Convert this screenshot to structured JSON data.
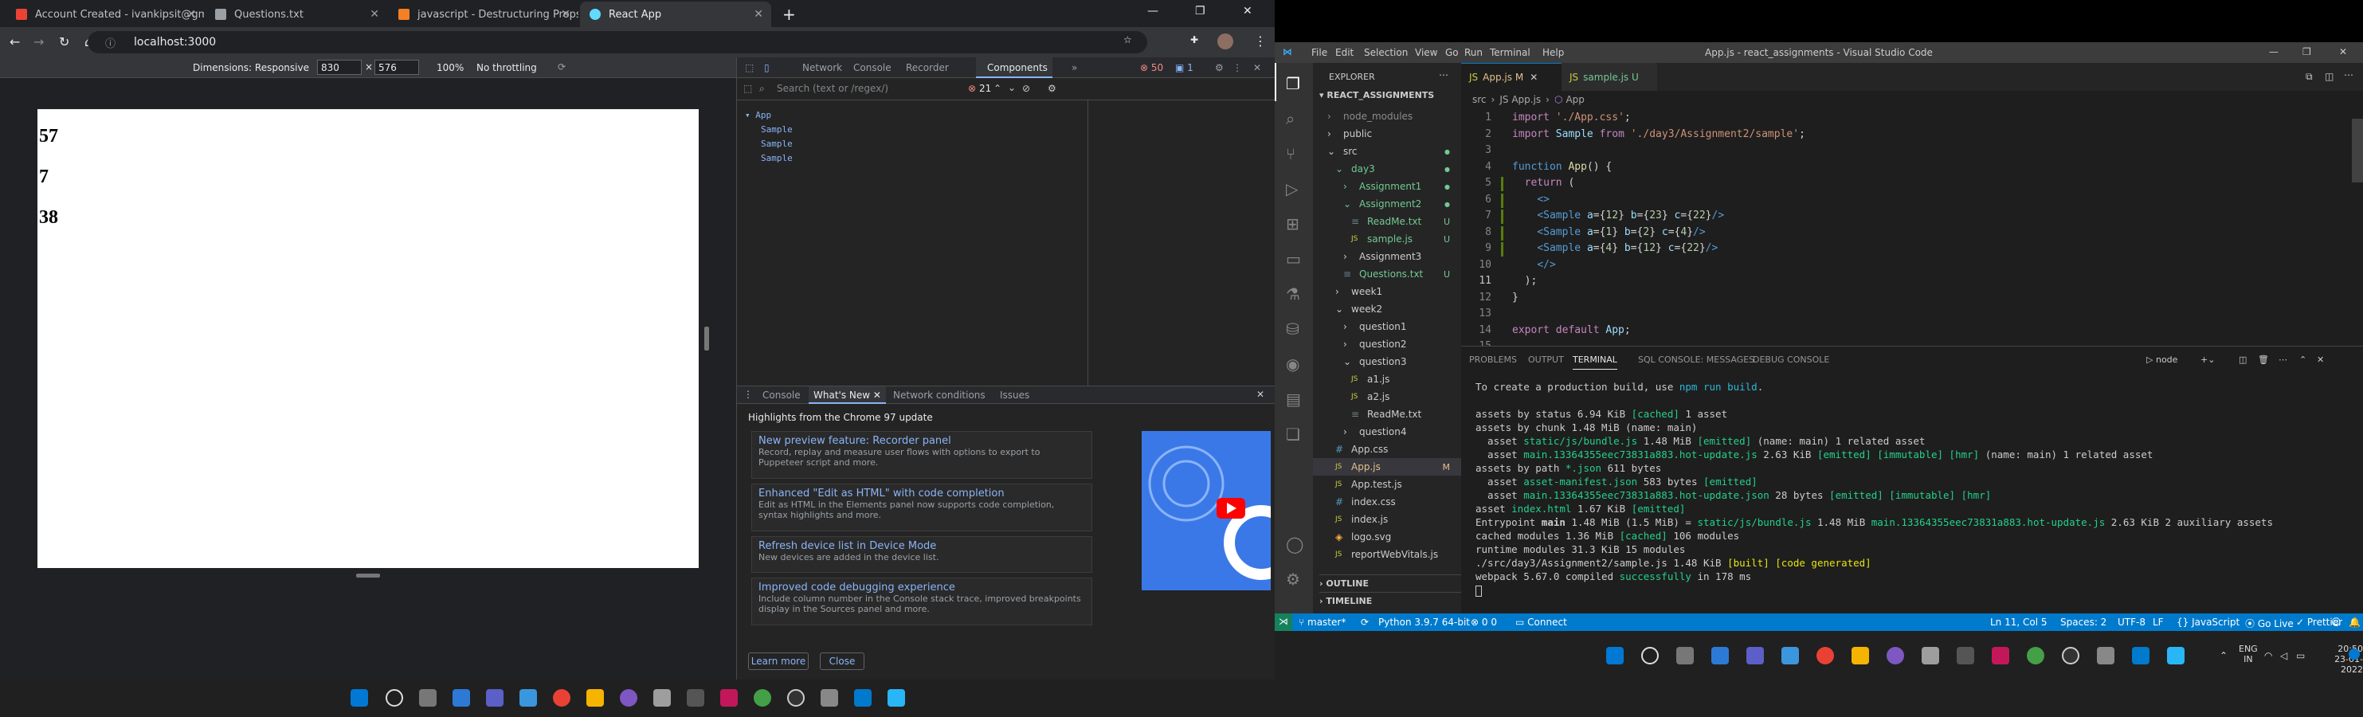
{
  "browser": {
    "tabs": [
      {
        "title": "Account Created - ivankipsit@gm",
        "fav": "#ea4335"
      },
      {
        "title": "Questions.txt",
        "fav": "#9aa0a6"
      },
      {
        "title": "javascript - Destructuring Props",
        "fav": "#f48024"
      },
      {
        "title": "React App",
        "fav": "#61dafb"
      }
    ],
    "url": "localhost:3000",
    "device": {
      "label": "Dimensions: Responsive",
      "width": "830",
      "height": "576",
      "zoom": "100%",
      "throttle": "No throttling"
    },
    "page_values": [
      "57",
      "7",
      "38"
    ]
  },
  "devtools": {
    "tabs": [
      "Network",
      "Console",
      "Recorder",
      "Components"
    ],
    "active_tab": "Components",
    "counts": {
      "errors": "50",
      "issues": "1"
    },
    "search_placeholder": "Search (text or /regex/)",
    "match_count": "21",
    "tree": {
      "root": "App",
      "children": [
        "Sample",
        "Sample",
        "Sample"
      ]
    },
    "drawer_tabs": [
      "Console",
      "What's New",
      "Network conditions",
      "Issues"
    ],
    "drawer_heading": "Highlights from the Chrome 97 update",
    "cards": [
      {
        "title": "New preview feature: Recorder panel",
        "desc": "Record, replay and measure user flows with options to export to Puppeteer script and more."
      },
      {
        "title": "Enhanced \"Edit as HTML\" with code completion",
        "desc": "Edit as HTML in the Elements panel now supports code completion, syntax highlights and more."
      },
      {
        "title": "Refresh device list in Device Mode",
        "desc": "New devices are added in the device list."
      },
      {
        "title": "Improved code debugging experience",
        "desc": "Include column number in the Console stack trace, improved breakpoints display in the Sources panel and more."
      }
    ],
    "learn_more": "Learn more",
    "close": "Close"
  },
  "vscode": {
    "menu": [
      "File",
      "Edit",
      "Selection",
      "View",
      "Go",
      "Run",
      "Terminal",
      "Help"
    ],
    "title": "App.js - react_assignments - Visual Studio Code",
    "explorer_label": "EXPLORER",
    "project": "REACT_ASSIGNMENTS",
    "tree": [
      {
        "name": "node_modules",
        "indent": 1,
        "kind": "folder",
        "color": "#8c8c8c",
        "badge": ""
      },
      {
        "name": "public",
        "indent": 1,
        "kind": "folder",
        "color": "#ccc",
        "badge": ""
      },
      {
        "name": "src",
        "indent": 1,
        "kind": "folder-open",
        "color": "#ccc",
        "badge": "dot"
      },
      {
        "name": "day3",
        "indent": 2,
        "kind": "folder-open",
        "color": "#73c991",
        "badge": "dot"
      },
      {
        "name": "Assignment1",
        "indent": 3,
        "kind": "folder",
        "color": "#73c991",
        "badge": "dot"
      },
      {
        "name": "Assignment2",
        "indent": 3,
        "kind": "folder-open",
        "color": "#73c991",
        "badge": "dot"
      },
      {
        "name": "ReadMe.txt",
        "indent": 4,
        "kind": "txt",
        "color": "#73c991",
        "badge": "U"
      },
      {
        "name": "sample.js",
        "indent": 4,
        "kind": "js",
        "color": "#73c991",
        "badge": "U"
      },
      {
        "name": "Assignment3",
        "indent": 3,
        "kind": "folder",
        "color": "#ccc",
        "badge": ""
      },
      {
        "name": "Questions.txt",
        "indent": 3,
        "kind": "txt",
        "color": "#73c991",
        "badge": "U"
      },
      {
        "name": "week1",
        "indent": 2,
        "kind": "folder",
        "color": "#ccc",
        "badge": ""
      },
      {
        "name": "week2",
        "indent": 2,
        "kind": "folder-open",
        "color": "#ccc",
        "badge": ""
      },
      {
        "name": "question1",
        "indent": 3,
        "kind": "folder",
        "color": "#ccc",
        "badge": ""
      },
      {
        "name": "question2",
        "indent": 3,
        "kind": "folder",
        "color": "#ccc",
        "badge": ""
      },
      {
        "name": "question3",
        "indent": 3,
        "kind": "folder-open",
        "color": "#ccc",
        "badge": ""
      },
      {
        "name": "a1.js",
        "indent": 4,
        "kind": "js",
        "color": "#ccc",
        "badge": ""
      },
      {
        "name": "a2.js",
        "indent": 4,
        "kind": "js",
        "color": "#ccc",
        "badge": ""
      },
      {
        "name": "ReadMe.txt",
        "indent": 4,
        "kind": "txt",
        "color": "#ccc",
        "badge": ""
      },
      {
        "name": "question4",
        "indent": 3,
        "kind": "folder",
        "color": "#ccc",
        "badge": ""
      },
      {
        "name": "App.css",
        "indent": 2,
        "kind": "css",
        "color": "#ccc",
        "badge": ""
      },
      {
        "name": "App.js",
        "indent": 2,
        "kind": "js",
        "color": "#e2c08d",
        "badge": "M"
      },
      {
        "name": "App.test.js",
        "indent": 2,
        "kind": "js",
        "color": "#ccc",
        "badge": ""
      },
      {
        "name": "index.css",
        "indent": 2,
        "kind": "css",
        "color": "#ccc",
        "badge": ""
      },
      {
        "name": "index.js",
        "indent": 2,
        "kind": "js",
        "color": "#ccc",
        "badge": ""
      },
      {
        "name": "logo.svg",
        "indent": 2,
        "kind": "svg",
        "color": "#ccc",
        "badge": ""
      },
      {
        "name": "reportWebVitals.js",
        "indent": 2,
        "kind": "js",
        "color": "#ccc",
        "badge": ""
      }
    ],
    "outline": "OUTLINE",
    "timeline": "TIMELINE",
    "editor_tabs": [
      {
        "name": "App.js",
        "flag": "M",
        "active": true
      },
      {
        "name": "sample.js",
        "flag": "U",
        "active": false
      }
    ],
    "breadcrumbs": [
      "src",
      "JS App.js",
      "App"
    ],
    "code": [
      [
        [
          "kw",
          "import "
        ],
        [
          "str",
          "'./App.css'"
        ],
        [
          "p",
          ";"
        ]
      ],
      [
        [
          "kw",
          "import "
        ],
        [
          "id",
          "Sample "
        ],
        [
          "kw",
          "from "
        ],
        [
          "str",
          "'./day3/Assignment2/sample'"
        ],
        [
          "p",
          ";"
        ]
      ],
      [],
      [
        [
          "kw",
          "function "
        ],
        [
          "fn",
          "App"
        ],
        [
          "p",
          "() {"
        ]
      ],
      [
        [
          "p",
          "  "
        ],
        [
          "kw",
          "return "
        ],
        [
          "p",
          "("
        ]
      ],
      [
        [
          "p",
          "    "
        ],
        [
          "tag",
          "<>"
        ]
      ],
      [
        [
          "p",
          "    "
        ],
        [
          "tag",
          "<Sample "
        ],
        [
          "id",
          "a"
        ],
        [
          "p",
          "={"
        ],
        [
          "num",
          "12"
        ],
        [
          "p",
          "} "
        ],
        [
          "id",
          "b"
        ],
        [
          "p",
          "={"
        ],
        [
          "num",
          "23"
        ],
        [
          "p",
          "} "
        ],
        [
          "id",
          "c"
        ],
        [
          "p",
          "={"
        ],
        [
          "num",
          "22"
        ],
        [
          "p",
          "}"
        ],
        [
          "tag",
          "/>"
        ]
      ],
      [
        [
          "p",
          "    "
        ],
        [
          "tag",
          "<Sample "
        ],
        [
          "id",
          "a"
        ],
        [
          "p",
          "={"
        ],
        [
          "num",
          "1"
        ],
        [
          "p",
          "} "
        ],
        [
          "id",
          "b"
        ],
        [
          "p",
          "={"
        ],
        [
          "num",
          "2"
        ],
        [
          "p",
          "} "
        ],
        [
          "id",
          "c"
        ],
        [
          "p",
          "={"
        ],
        [
          "num",
          "4"
        ],
        [
          "p",
          "}"
        ],
        [
          "tag",
          "/>"
        ]
      ],
      [
        [
          "p",
          "    "
        ],
        [
          "tag",
          "<Sample "
        ],
        [
          "id",
          "a"
        ],
        [
          "p",
          "={"
        ],
        [
          "num",
          "4"
        ],
        [
          "p",
          "} "
        ],
        [
          "id",
          "b"
        ],
        [
          "p",
          "={"
        ],
        [
          "num",
          "12"
        ],
        [
          "p",
          "} "
        ],
        [
          "id",
          "c"
        ],
        [
          "p",
          "={"
        ],
        [
          "num",
          "22"
        ],
        [
          "p",
          "}"
        ],
        [
          "tag",
          "/>"
        ]
      ],
      [
        [
          "p",
          "    "
        ],
        [
          "tag",
          "</>"
        ]
      ],
      [
        [
          "p",
          "  );"
        ]
      ],
      [
        [
          "p",
          "}"
        ]
      ],
      [],
      [
        [
          "kw",
          "export default "
        ],
        [
          "id",
          "App"
        ],
        [
          "p",
          ";"
        ]
      ],
      []
    ],
    "panel_tabs": [
      "PROBLEMS",
      "OUTPUT",
      "TERMINAL",
      "SQL CONSOLE: MESSAGES",
      "DEBUG CONSOLE"
    ],
    "active_panel": "TERMINAL",
    "terminal_name": "node",
    "terminal": [
      [
        [
          "",
          "To create a production build, use "
        ],
        [
          "cyan",
          "npm run build"
        ],
        [
          "",
          "."
        ]
      ],
      [],
      [
        [
          "",
          "assets by status 6.94 KiB "
        ],
        [
          "ygreen",
          "[cached]"
        ],
        [
          "",
          " 1 asset"
        ]
      ],
      [
        [
          "",
          "assets by chunk 1.48 MiB (name: main)"
        ]
      ],
      [
        [
          "",
          "  asset "
        ],
        [
          "ygreen",
          "static/js/bundle.js"
        ],
        [
          "",
          " 1.48 MiB "
        ],
        [
          "ygreen",
          "[emitted]"
        ],
        [
          "",
          " (name: main) 1 related asset"
        ]
      ],
      [
        [
          "",
          "  asset "
        ],
        [
          "ygreen",
          "main.13364355eec73831a883.hot-update.js"
        ],
        [
          "",
          " 2.63 KiB "
        ],
        [
          "ygreen",
          "[emitted] [immutable] [hmr]"
        ],
        [
          "",
          " (name: main) 1 related asset"
        ]
      ],
      [
        [
          "",
          "assets by path "
        ],
        [
          "ygreen",
          "*.json"
        ],
        [
          "",
          " 611 bytes"
        ]
      ],
      [
        [
          "",
          "  asset "
        ],
        [
          "ygreen",
          "asset-manifest.json"
        ],
        [
          "",
          " 583 bytes "
        ],
        [
          "ygreen",
          "[emitted]"
        ]
      ],
      [
        [
          "",
          "  asset "
        ],
        [
          "ygreen",
          "main.13364355eec73831a883.hot-update.json"
        ],
        [
          "",
          " 28 bytes "
        ],
        [
          "ygreen",
          "[emitted] [immutable] [hmr]"
        ]
      ],
      [
        [
          "",
          "asset "
        ],
        [
          "ygreen",
          "index.html"
        ],
        [
          "",
          " 1.67 KiB "
        ],
        [
          "ygreen",
          "[emitted]"
        ]
      ],
      [
        [
          "",
          "Entrypoint "
        ],
        [
          "bold",
          "main"
        ],
        [
          "",
          " 1.48 MiB (1.5 MiB) = "
        ],
        [
          "ygreen",
          "static/js/bundle.js"
        ],
        [
          "",
          " 1.48 MiB "
        ],
        [
          "ygreen",
          "main.13364355eec73831a883.hot-update.js"
        ],
        [
          "",
          " 2.63 KiB 2 auxiliary assets"
        ]
      ],
      [
        [
          "",
          "cached modules 1.36 MiB "
        ],
        [
          "ygreen",
          "[cached]"
        ],
        [
          "",
          " 106 modules"
        ]
      ],
      [
        [
          "",
          "runtime modules 31.3 KiB 15 modules"
        ]
      ],
      [
        [
          "",
          "./src/day3/Assignment2/sample.js 1.48 KiB "
        ],
        [
          "yellow",
          "[built] [code generated]"
        ]
      ],
      [
        [
          "",
          "webpack 5.67.0 compiled "
        ],
        [
          "ygreen",
          "successfully"
        ],
        [
          "",
          " in 178 ms"
        ]
      ]
    ],
    "status_left": [
      "master*",
      "Python 3.9.7 64-bit",
      "0 0",
      "Connect"
    ],
    "status_right": [
      "Ln 11, Col 5",
      "Spaces: 2",
      "UTF-8",
      "LF",
      "{} JavaScript",
      "Go Live",
      "Prettier"
    ],
    "tray": {
      "lang": "ENG",
      "region": "IN",
      "time": "20:50",
      "date": "23-01-2022"
    }
  }
}
